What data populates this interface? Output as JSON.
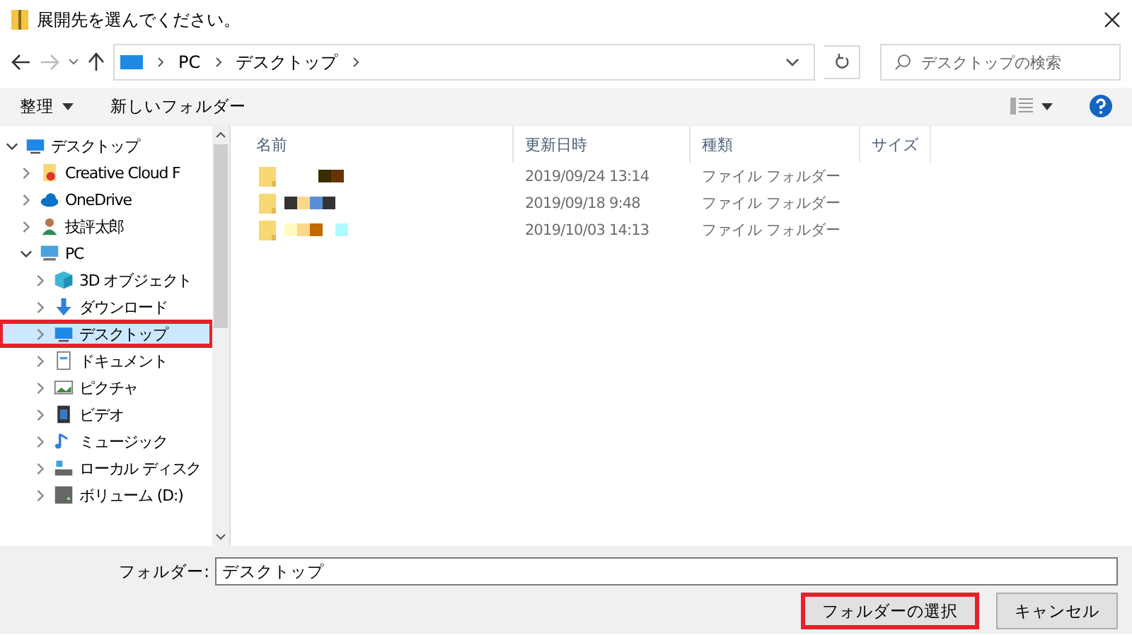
{
  "window": {
    "title": "展開先を選んでください。"
  },
  "address": {
    "crumbs": [
      "PC",
      "デスクトップ"
    ]
  },
  "search": {
    "placeholder": "デスクトップの検索"
  },
  "toolbar": {
    "organize": "整理",
    "new_folder": "新しいフォルダー"
  },
  "tree": [
    {
      "label": "デスクトップ",
      "kind": "desktop",
      "expanded": true,
      "selected": false,
      "highlighted": false,
      "children": [
        {
          "label": "Creative Cloud F",
          "kind": "cc",
          "expanded": false,
          "selected": false,
          "highlighted": false
        },
        {
          "label": "OneDrive",
          "kind": "cloud",
          "expanded": false,
          "selected": false,
          "highlighted": false
        },
        {
          "label": "技評太郎",
          "kind": "user",
          "expanded": false,
          "selected": false,
          "highlighted": false
        },
        {
          "label": "PC",
          "kind": "pc",
          "expanded": true,
          "selected": false,
          "highlighted": false,
          "children": [
            {
              "label": "3D オブジェクト",
              "kind": "cube",
              "expanded": false,
              "selected": false,
              "highlighted": false
            },
            {
              "label": "ダウンロード",
              "kind": "download",
              "expanded": false,
              "selected": false,
              "highlighted": false
            },
            {
              "label": "デスクトップ",
              "kind": "desktop",
              "expanded": false,
              "selected": true,
              "highlighted": true
            },
            {
              "label": "ドキュメント",
              "kind": "doc",
              "expanded": false,
              "selected": false,
              "highlighted": false
            },
            {
              "label": "ピクチャ",
              "kind": "picture",
              "expanded": false,
              "selected": false,
              "highlighted": false
            },
            {
              "label": "ビデオ",
              "kind": "video",
              "expanded": false,
              "selected": false,
              "highlighted": false
            },
            {
              "label": "ミュージック",
              "kind": "music",
              "expanded": false,
              "selected": false,
              "highlighted": false
            },
            {
              "label": "ローカル ディスク",
              "kind": "disk",
              "expanded": false,
              "selected": false,
              "highlighted": false
            },
            {
              "label": "ボリューム (D:)",
              "kind": "drive",
              "expanded": false,
              "selected": false,
              "highlighted": false
            }
          ]
        }
      ]
    }
  ],
  "table": {
    "columns": [
      "名前",
      "更新日時",
      "種類",
      "サイズ"
    ],
    "rows": [
      {
        "modified": "2019/09/24 13:14",
        "type": "ファイル フォルダー"
      },
      {
        "modified": "2019/09/18 9:48",
        "type": "ファイル フォルダー"
      },
      {
        "modified": "2019/10/03 14:13",
        "type": "ファイル フォルダー"
      }
    ]
  },
  "footer": {
    "folder_label": "フォルダー:",
    "folder_value": "デスクトップ",
    "buttons": [
      {
        "label": "フォルダーの選択",
        "highlighted": true
      },
      {
        "label": "キャンセル",
        "highlighted": false
      }
    ]
  }
}
